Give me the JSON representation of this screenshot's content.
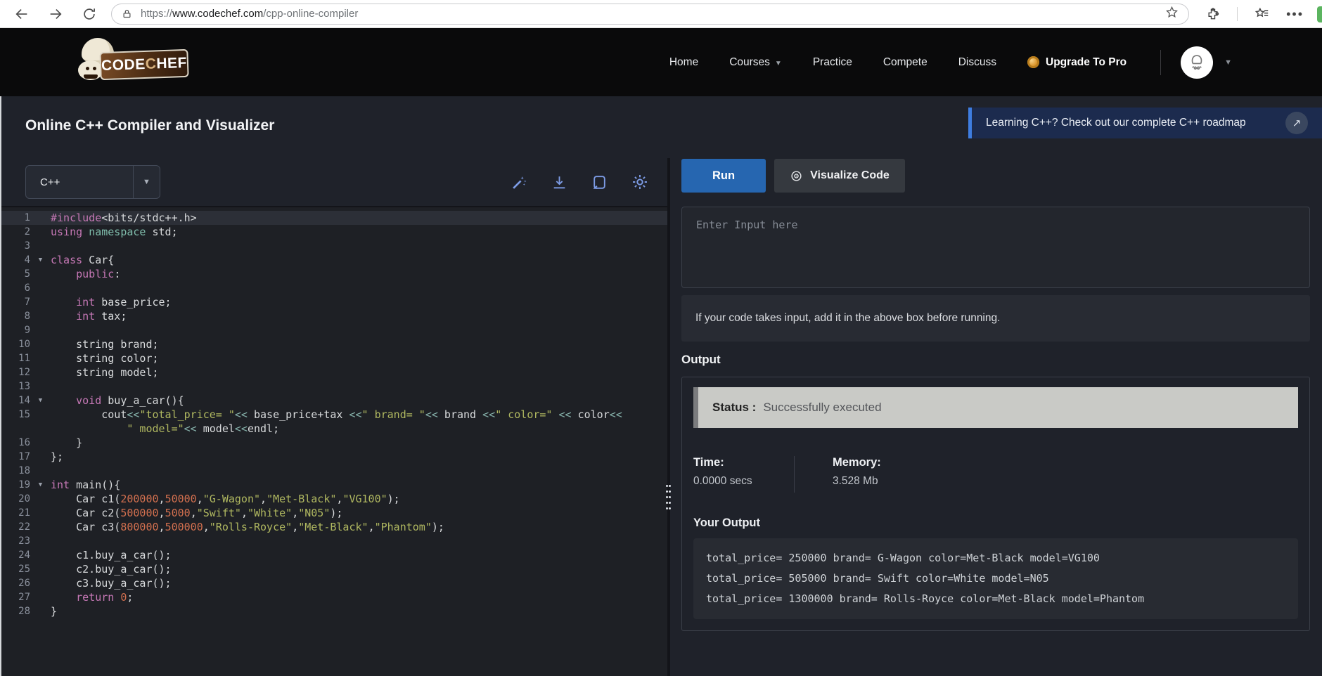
{
  "browser": {
    "url": {
      "scheme": "https://",
      "domain": "www.codechef.com",
      "path": "/cpp-online-compiler"
    }
  },
  "header": {
    "logo": {
      "part1": "CODE",
      "part2": "C",
      "part3": "HEF"
    },
    "nav": [
      "Home",
      "Courses",
      "Practice",
      "Compete",
      "Discuss"
    ],
    "upgrade_label": "Upgrade To Pro"
  },
  "page": {
    "title": "Online C++ Compiler and Visualizer",
    "banner": {
      "text": "Learning C++? Check out our complete C++ roadmap",
      "arrow": "↗"
    }
  },
  "toolbar": {
    "language": "C++"
  },
  "colors": {
    "accent_blue": "#2666b0",
    "icon_blue": "#7d9ce6",
    "banner_border": "#3e7de0",
    "keyword": "#c678b6",
    "string": "#b0b860",
    "number": "#d3704f",
    "operator": "#87b3ac",
    "status_bar": "#c9cac6"
  },
  "editor": {
    "lines": [
      {
        "n": "1",
        "active": true,
        "tokens": [
          [
            "k",
            "#include"
          ],
          [
            "p",
            "<bits/stdc++.h>"
          ]
        ]
      },
      {
        "n": "2",
        "tokens": [
          [
            "k",
            "using"
          ],
          [
            "p",
            " "
          ],
          [
            "t",
            "namespace"
          ],
          [
            "p",
            " std;"
          ]
        ]
      },
      {
        "n": "3",
        "tokens": []
      },
      {
        "n": "4",
        "fold": true,
        "tokens": [
          [
            "k",
            "class"
          ],
          [
            "p",
            " Car{"
          ]
        ]
      },
      {
        "n": "5",
        "tokens": [
          [
            "p",
            "    "
          ],
          [
            "k",
            "public"
          ],
          [
            "p",
            ":"
          ]
        ]
      },
      {
        "n": "6",
        "tokens": []
      },
      {
        "n": "7",
        "tokens": [
          [
            "p",
            "    "
          ],
          [
            "k",
            "int"
          ],
          [
            "p",
            " base_price;"
          ]
        ]
      },
      {
        "n": "8",
        "tokens": [
          [
            "p",
            "    "
          ],
          [
            "k",
            "int"
          ],
          [
            "p",
            " tax;"
          ]
        ]
      },
      {
        "n": "9",
        "tokens": []
      },
      {
        "n": "10",
        "tokens": [
          [
            "p",
            "    string brand;"
          ]
        ]
      },
      {
        "n": "11",
        "tokens": [
          [
            "p",
            "    string color;"
          ]
        ]
      },
      {
        "n": "12",
        "tokens": [
          [
            "p",
            "    string model;"
          ]
        ]
      },
      {
        "n": "13",
        "tokens": []
      },
      {
        "n": "14",
        "fold": true,
        "tokens": [
          [
            "p",
            "    "
          ],
          [
            "k",
            "void"
          ],
          [
            "p",
            " buy_a_car(){"
          ]
        ]
      },
      {
        "n": "15",
        "tokens": [
          [
            "p",
            "        cout"
          ],
          [
            "o",
            "<<"
          ],
          [
            "s",
            "\"total_price= \""
          ],
          [
            "o",
            "<<"
          ],
          [
            "p",
            " base_price+tax "
          ],
          [
            "o",
            "<<"
          ],
          [
            "s",
            "\" brand= \""
          ],
          [
            "o",
            "<<"
          ],
          [
            "p",
            " brand "
          ],
          [
            "o",
            "<<"
          ],
          [
            "s",
            "\" color=\""
          ],
          [
            "p",
            " "
          ],
          [
            "o",
            "<<"
          ],
          [
            "p",
            " color"
          ],
          [
            "o",
            "<<"
          ]
        ]
      },
      {
        "n": "",
        "tokens": [
          [
            "p",
            "            "
          ],
          [
            "s",
            "\" model=\""
          ],
          [
            "o",
            "<<"
          ],
          [
            "p",
            " model"
          ],
          [
            "o",
            "<<"
          ],
          [
            "p",
            "endl;"
          ]
        ]
      },
      {
        "n": "16",
        "tokens": [
          [
            "p",
            "    }"
          ]
        ]
      },
      {
        "n": "17",
        "tokens": [
          [
            "p",
            "};"
          ]
        ]
      },
      {
        "n": "18",
        "tokens": []
      },
      {
        "n": "19",
        "fold": true,
        "tokens": [
          [
            "k",
            "int"
          ],
          [
            "p",
            " main(){"
          ]
        ]
      },
      {
        "n": "20",
        "tokens": [
          [
            "p",
            "    Car c1("
          ],
          [
            "n",
            "200000"
          ],
          [
            "p",
            ","
          ],
          [
            "n",
            "50000"
          ],
          [
            "p",
            ","
          ],
          [
            "s",
            "\"G-Wagon\""
          ],
          [
            "p",
            ","
          ],
          [
            "s",
            "\"Met-Black\""
          ],
          [
            "p",
            ","
          ],
          [
            "s",
            "\"VG100\""
          ],
          [
            "p",
            ");"
          ]
        ]
      },
      {
        "n": "21",
        "tokens": [
          [
            "p",
            "    Car c2("
          ],
          [
            "n",
            "500000"
          ],
          [
            "p",
            ","
          ],
          [
            "n",
            "5000"
          ],
          [
            "p",
            ","
          ],
          [
            "s",
            "\"Swift\""
          ],
          [
            "p",
            ","
          ],
          [
            "s",
            "\"White\""
          ],
          [
            "p",
            ","
          ],
          [
            "s",
            "\"N05\""
          ],
          [
            "p",
            ");"
          ]
        ]
      },
      {
        "n": "22",
        "tokens": [
          [
            "p",
            "    Car c3("
          ],
          [
            "n",
            "800000"
          ],
          [
            "p",
            ","
          ],
          [
            "n",
            "500000"
          ],
          [
            "p",
            ","
          ],
          [
            "s",
            "\"Rolls-Royce\""
          ],
          [
            "p",
            ","
          ],
          [
            "s",
            "\"Met-Black\""
          ],
          [
            "p",
            ","
          ],
          [
            "s",
            "\"Phantom\""
          ],
          [
            "p",
            ");"
          ]
        ]
      },
      {
        "n": "23",
        "tokens": []
      },
      {
        "n": "24",
        "tokens": [
          [
            "p",
            "    c1.buy_a_car();"
          ]
        ]
      },
      {
        "n": "25",
        "tokens": [
          [
            "p",
            "    c2.buy_a_car();"
          ]
        ]
      },
      {
        "n": "26",
        "tokens": [
          [
            "p",
            "    c3.buy_a_car();"
          ]
        ]
      },
      {
        "n": "27",
        "tokens": [
          [
            "p",
            "    "
          ],
          [
            "k",
            "return"
          ],
          [
            "p",
            " "
          ],
          [
            "n",
            "0"
          ],
          [
            "p",
            ";"
          ]
        ]
      },
      {
        "n": "28",
        "tokens": [
          [
            "p",
            "}"
          ]
        ]
      }
    ]
  },
  "runner": {
    "run_label": "Run",
    "visualize_label": "Visualize Code",
    "input_placeholder": "Enter Input here",
    "note": "If your code takes input, add it in the above box before running.",
    "output_heading": "Output",
    "status_label": "Status :",
    "status_value": "Successfully executed",
    "time_label": "Time:",
    "time_value": "0.0000 secs",
    "memory_label": "Memory:",
    "memory_value": "3.528 Mb",
    "your_output_label": "Your Output",
    "output_lines": [
      "total_price= 250000 brand= G-Wagon color=Met-Black model=VG100",
      "total_price= 505000 brand= Swift color=White model=N05",
      "total_price= 1300000 brand= Rolls-Royce color=Met-Black model=Phantom"
    ]
  }
}
